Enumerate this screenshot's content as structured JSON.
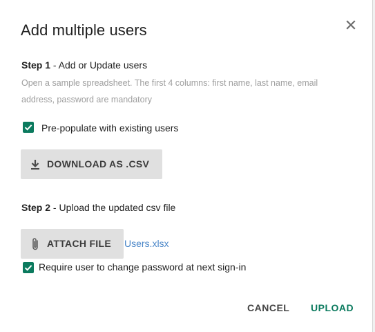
{
  "dialog": {
    "title": "Add multiple users",
    "close_icon": "close-icon"
  },
  "step1": {
    "label": "Step 1",
    "text": " - Add or Update users",
    "description": "Open a sample spreadsheet. The first 4 columns: first name, last name, email address, password are mandatory",
    "checkbox": {
      "label": "Pre-populate with existing users",
      "checked": true
    },
    "download_button": {
      "label": "DOWNLOAD AS .CSV",
      "icon": "download-icon"
    }
  },
  "step2": {
    "label": "Step 2",
    "text": " - Upload the updated csv file",
    "attach_button": {
      "label": "ATTACH FILE",
      "icon": "paperclip-icon"
    },
    "filename": "Users.xlsx",
    "checkbox": {
      "label": "Require user to change password at next sign-in",
      "checked": true
    }
  },
  "footer": {
    "cancel_label": "CANCEL",
    "upload_label": "UPLOAD"
  },
  "colors": {
    "accent": "#0b7a5e",
    "link": "#4a86c8",
    "button_bg": "#e0e0e0"
  }
}
